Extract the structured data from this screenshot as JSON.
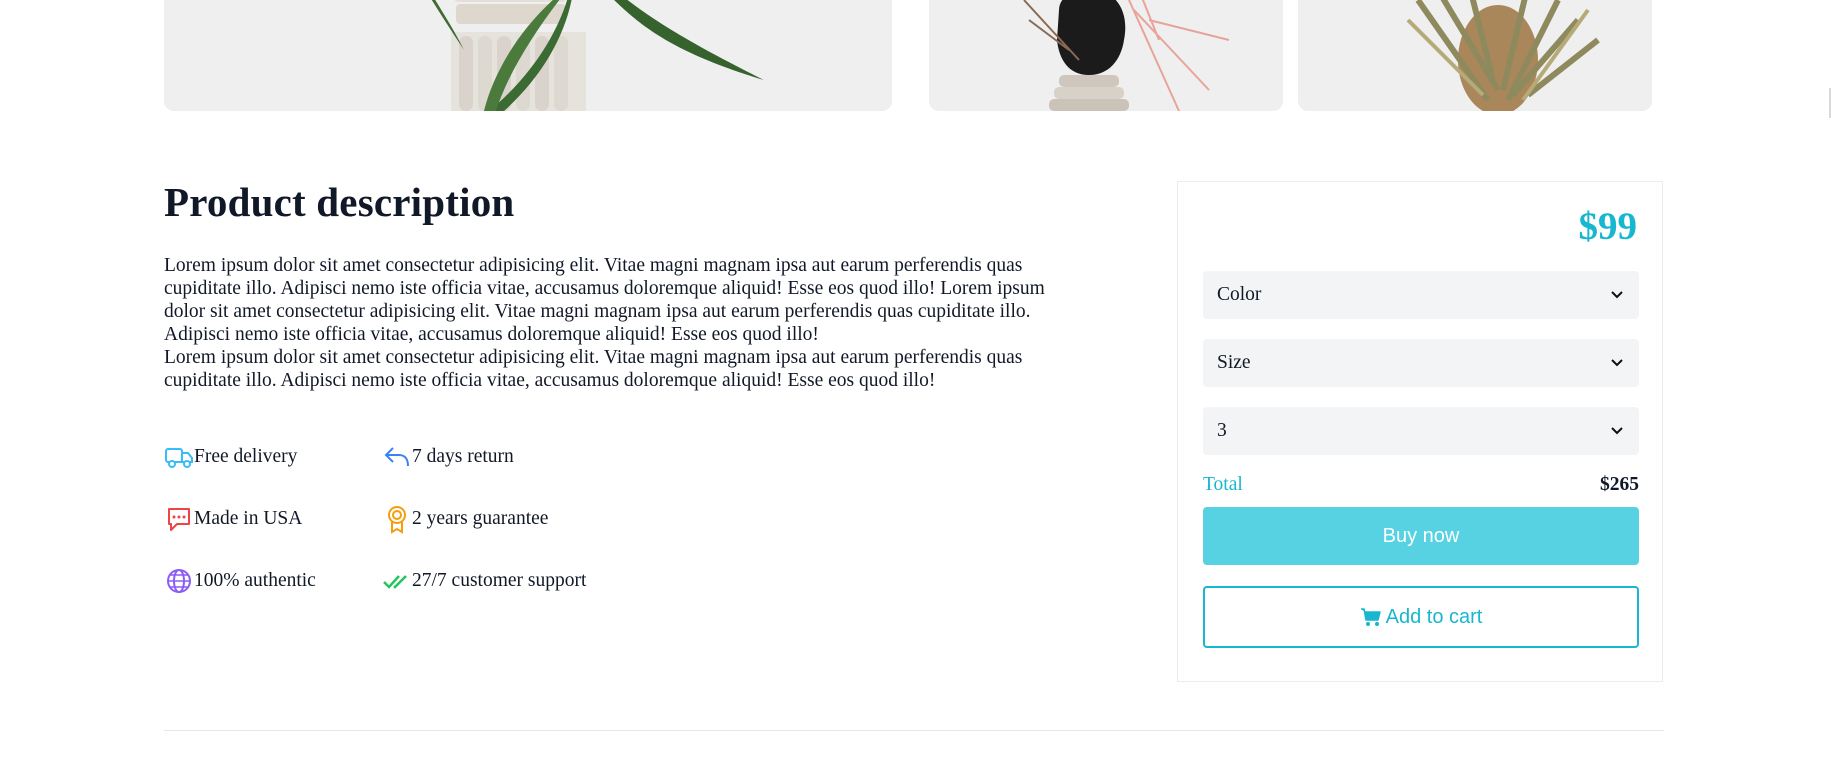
{
  "description": {
    "title": "Product description",
    "paragraph_1": "Lorem ipsum dolor sit amet consectetur adipisicing elit. Vitae magni magnam ipsa aut earum perferendis quas cupiditate illo. Adipisci nemo iste officia vitae, accusamus doloremque aliquid! Esse eos quod illo! Lorem ipsum dolor sit amet consectetur adipisicing elit. Vitae magni magnam ipsa aut earum perferendis quas cupiditate illo. Adipisci nemo iste officia vitae, accusamus doloremque aliquid! Esse eos quod illo!",
    "paragraph_2": "Lorem ipsum dolor sit amet consectetur adipisicing elit. Vitae magni magnam ipsa aut earum perferendis quas cupiditate illo. Adipisci nemo iste officia vitae, accusamus doloremque aliquid! Esse eos quod illo!"
  },
  "features": [
    {
      "label": "Free delivery",
      "icon": "truck-icon",
      "color": "#38bdf8"
    },
    {
      "label": "7 days return",
      "icon": "return-arrow-icon",
      "color": "#3b82f6"
    },
    {
      "label": "Made in USA",
      "icon": "chat-bubble-icon",
      "color": "#ef4444"
    },
    {
      "label": "2 years guarantee",
      "icon": "award-badge-icon",
      "color": "#f59e0b"
    },
    {
      "label": "100% authentic",
      "icon": "globe-icon",
      "color": "#8b5cf6"
    },
    {
      "label": "27/7 customer support",
      "icon": "double-check-icon",
      "color": "#22c55e"
    }
  ],
  "purchase": {
    "price": "$99",
    "color_select": "Color",
    "size_select": "Size",
    "quantity_select": "3",
    "total_label": "Total",
    "total_value": "$265",
    "buy_label": "Buy now",
    "cart_label": "Add to cart",
    "accent_color": "#17b7cf",
    "buy_button_color": "#56d2e2"
  }
}
